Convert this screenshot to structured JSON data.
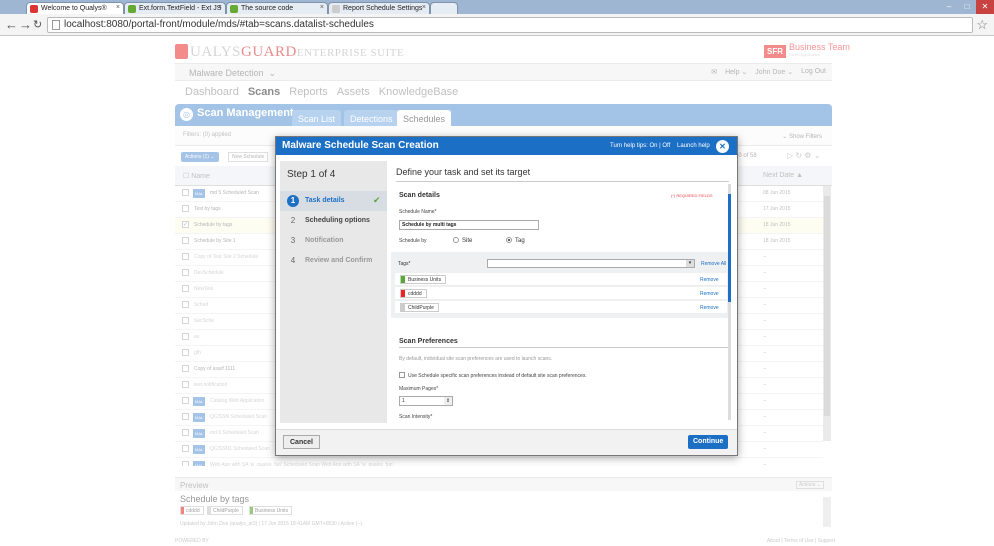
{
  "browser": {
    "tabs": [
      {
        "label": "Welcome to Qualys®",
        "color": "#d33"
      },
      {
        "label": "Ext.form.TextField - Ext JS",
        "color": "#6a3"
      },
      {
        "label": "The source code",
        "color": "#6a3"
      },
      {
        "label": "Report Schedule Settings",
        "color": "#ccc"
      }
    ],
    "url": "localhost:8080/portal-front/module/mds/#tab=scans.datalist-schedules"
  },
  "app": {
    "logo_prefix": "UALYS",
    "logo_mid": "GUARD",
    "logo_suffix": "ENTERPRISE SUITE",
    "brand_box": "SFR",
    "brand_text": "Business Team",
    "brand_sub": "Demo Application",
    "module_select": "Malware Detection",
    "help": "Help",
    "user": "John Doe",
    "logout": "Log Out",
    "menu": [
      "Dashboard",
      "Scans",
      "Reports",
      "Assets",
      "KnowledgeBase"
    ],
    "module_title": "Scan Management",
    "module_tabs": [
      "Scan List",
      "Detections",
      "Schedules"
    ],
    "filters_applied": "Filters: (0) applied",
    "show_filters": "Show Filters",
    "actions_btn": "Actions (1)",
    "new_schedule_btn": "New Schedule",
    "paging": "40 of 58",
    "col_name": "Name",
    "col_next_date": "Next Date"
  },
  "grid": {
    "rows": [
      {
        "name": "md 5 Scheduled Scan",
        "date": "08 Jun 2015",
        "badge": "MAL",
        "dim": false
      },
      {
        "name": "Test by tags",
        "date": "17 Jun 2015",
        "badge": "",
        "dim": false
      },
      {
        "name": "Schedule by tags",
        "date": "18 Jun 2015",
        "badge": "",
        "dim": false,
        "selected": true
      },
      {
        "name": "Schedule by Site 1",
        "date": "18 Jun 2015",
        "badge": "",
        "dim": false
      },
      {
        "name": "Copy of Test Site 2 Schedule",
        "date": "--",
        "badge": "",
        "dim": true
      },
      {
        "name": "DevSchedule",
        "date": "--",
        "badge": "",
        "dim": true
      },
      {
        "name": "NewTest",
        "date": "--",
        "badge": "",
        "dim": true
      },
      {
        "name": "Sched",
        "date": "--",
        "badge": "",
        "dim": true
      },
      {
        "name": "SecSche",
        "date": "--",
        "badge": "",
        "dim": true
      },
      {
        "name": "as",
        "date": "--",
        "badge": "",
        "dim": true
      },
      {
        "name": "gfh",
        "date": "--",
        "badge": "",
        "dim": true
      },
      {
        "name": "Copy of asarf 1111",
        "date": "--",
        "badge": "",
        "dim": false
      },
      {
        "name": "test notification",
        "date": "--",
        "badge": "",
        "dim": true
      },
      {
        "name": "Catalog Web Application",
        "date": "--",
        "badge": "MAL",
        "dim": true
      },
      {
        "name": "QC/SSN Scheduled Scan",
        "date": "--",
        "badge": "MAL",
        "dim": true
      },
      {
        "name": "md 6 Scheduled Scan",
        "date": "--",
        "badge": "MAL",
        "dim": true
      },
      {
        "name": "QC/SSN1 Scheduled Scan",
        "date": "--",
        "badge": "MAL",
        "dim": true
      },
      {
        "name": "Web App with SA 'w_qualys_fun' Scheduled Scan    Web App with SA 'w_qualys_fun'",
        "date": "--",
        "badge": "MAL",
        "dim": true
      }
    ]
  },
  "preview": {
    "header": "Preview",
    "actions": "Actions",
    "title": "Schedule by tags",
    "tags": [
      {
        "label": "cdddd",
        "color": "#e33"
      },
      {
        "label": "ChildPurple",
        "color": "#ccc"
      },
      {
        "label": "Business Units",
        "color": "#5a3"
      }
    ],
    "updated": "Updated by John Doe (qualys_at3) | 17 Jun 2015 18:41AM GMT+0530 | Active (--)"
  },
  "footer": {
    "powered": "POWERED BY",
    "links": "About | Terms of Use | Support"
  },
  "dialog": {
    "title": "Malware Schedule Scan Creation",
    "help_tips": "Turn help tips: On | Off",
    "launch_help": "Launch help",
    "step_title": "Step 1 of 4",
    "steps": [
      {
        "num": "1",
        "label": "Task details"
      },
      {
        "num": "2",
        "label": "Scheduling options"
      },
      {
        "num": "3",
        "label": "Notification"
      },
      {
        "num": "4",
        "label": "Review and Confirm"
      }
    ],
    "content_header": "Define your task and set its target",
    "scan_details": "Scan details",
    "required": "(*) REQUIRED FIELDS",
    "schedule_name_label": "Schedule Name*",
    "schedule_name_value": "Schedule by multi tags",
    "schedule_by_label": "Schedule by",
    "radio_site": "Site",
    "radio_tag": "Tag",
    "tags_label": "Tags*",
    "remove_all": "Remove All",
    "tags": [
      {
        "label": "Business Units",
        "color": "#5a3"
      },
      {
        "label": "cdddd",
        "color": "#e22"
      },
      {
        "label": "ChildPurple",
        "color": "#ccc"
      }
    ],
    "remove": "Remove",
    "scan_prefs": "Scan Preferences",
    "scan_prefs_desc": "By default, individual site scan preferences are used to launch scans.",
    "use_specific": "Use Schedule specific scan preferences instead of default site scan preferences.",
    "max_pages_label": "Maximum Pages*",
    "max_pages_value": "1",
    "scan_intensity": "Scan Intensity*",
    "cancel": "Cancel",
    "continue": "Continue"
  }
}
